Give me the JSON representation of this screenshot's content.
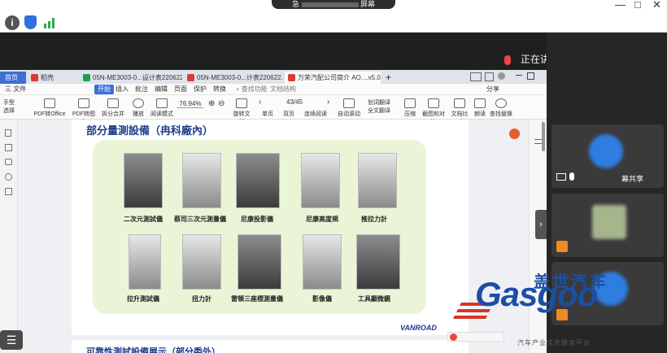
{
  "topbar": {
    "share_title_prefix": "急",
    "share_title_suffix": "屏幕",
    "info_icon": "info-icon",
    "shield_icon": "shield-icon",
    "signal_icon": "signal-icon"
  },
  "speaker": {
    "label": "正在讲",
    "mic_icon": "mic-muted-icon"
  },
  "tabs": [
    {
      "label": "首页",
      "color": "#6b7a90"
    },
    {
      "label": "稻壳",
      "color": "#d93b3b"
    },
    {
      "label": "05N-ME3003-0...设计表220622 V2",
      "color": "#1f9d55"
    },
    {
      "label": "05N-ME3003-0...计表220622.pdf",
      "color": "#d93b3b"
    },
    {
      "label": "万荣汽配公司简介 AO....v5.0(1).pdf",
      "color": "#d93b3b"
    }
  ],
  "tab_add": "+",
  "menu": {
    "file": "三 文件",
    "items": [
      "开始",
      "插入",
      "批注",
      "编辑",
      "页面",
      "保护",
      "转换"
    ],
    "search": "查找功能",
    "search2": "文档结构",
    "share": "分享"
  },
  "toolbar": {
    "hand": "手型",
    "select": "选择",
    "pdf_office": "PDF转Office",
    "pdf_img": "PDF转图片",
    "split": "拆分合并",
    "play": "播放",
    "read_mode": "阅读模式",
    "zoom": "76.94%",
    "rotate": "旋转文档",
    "single": "单页",
    "double": "双页",
    "continuous": "连续阅读",
    "auto_scroll": "自动滚动",
    "page": "43/45",
    "translate": "划词翻译",
    "full_translate": "全文翻译",
    "compress": "压缩",
    "screenshot": "截图和对比",
    "doc_compare": "文档比对",
    "read_aloud": "朗读",
    "find_replace": "查找替换"
  },
  "slide": {
    "title": "部分量測設備（冉科廠內）",
    "items": [
      {
        "label": "二次元測試儀",
        "tone": "dark"
      },
      {
        "label": "蔡司三次元測量儀",
        "tone": "light"
      },
      {
        "label": "尼康投影儀",
        "tone": "dark"
      },
      {
        "label": "尼康高度規",
        "tone": "light"
      },
      {
        "label": "推拉力計",
        "tone": "light"
      },
      {
        "label": "拉升測試儀",
        "tone": "light"
      },
      {
        "label": "扭力計",
        "tone": "light"
      },
      {
        "label": "雷頓三座標測量儀",
        "tone": "dark"
      },
      {
        "label": "影像儀",
        "tone": "light"
      },
      {
        "label": "工具顯微鏡",
        "tone": "dark"
      }
    ],
    "next_title": "可靠性測試設備展示（部分委外）",
    "brand": "VANROAD"
  },
  "participants": [
    {
      "label": "幕共享",
      "color": "#2f7de1"
    },
    {
      "label": "",
      "color": "#a6b58c"
    },
    {
      "label": "",
      "color": "#2f7de1"
    }
  ],
  "watermark": {
    "cn": "盖世汽车",
    "en": "Gasgoo",
    "sub": "汽车产业信息服务平台"
  },
  "colors": {
    "accent": "#1b4fa6",
    "panel": "#e9f5d6",
    "titlebar": "#dfe3ea"
  }
}
